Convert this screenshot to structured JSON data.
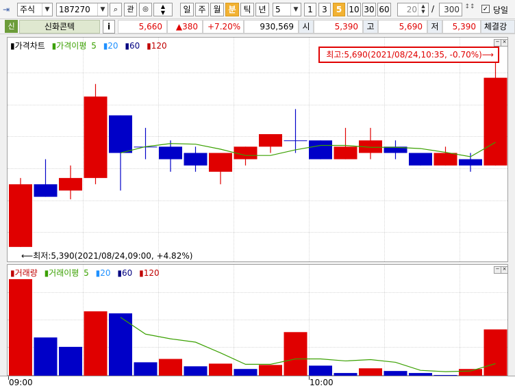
{
  "toolbar": {
    "market": "주식",
    "code": "187270",
    "buttons": [
      "관"
    ],
    "periods": [
      {
        "label": "일",
        "active": false
      },
      {
        "label": "주",
        "active": false
      },
      {
        "label": "월",
        "active": false
      },
      {
        "label": "분",
        "active": true
      },
      {
        "label": "틱",
        "active": false
      },
      {
        "label": "년",
        "active": false
      }
    ],
    "interval_value": "5",
    "minutes": [
      {
        "label": "1",
        "active": false
      },
      {
        "label": "3",
        "active": false
      },
      {
        "label": "5",
        "active": true
      },
      {
        "label": "10",
        "active": false
      },
      {
        "label": "30",
        "active": false
      },
      {
        "label": "60",
        "active": false
      }
    ],
    "count_value": "20",
    "slash": "/",
    "total_value": "300",
    "today_label": "당일",
    "today_checked": true
  },
  "quote": {
    "badge": "신",
    "name": "신화콘텍",
    "info_button": "i",
    "price": "5,660",
    "change": "▲380",
    "change_pct": "+7.20%",
    "volume": "930,569",
    "open_label": "시",
    "open": "5,390",
    "high_label": "고",
    "high": "5,690",
    "low_label": "저",
    "low": "5,390",
    "exec_label": "체결강"
  },
  "price_panel": {
    "legend": {
      "main": "가격차트",
      "ma_label": "가격이평",
      "ma5": "5",
      "ma20": "20",
      "ma60": "60",
      "ma120": "120"
    },
    "high_annotation": "최고:5,690(2021/08/24,10:35, -0.70%)⟶",
    "low_annotation": "⟵최저:5,390(2021/08/24,09:00, +4.82%)"
  },
  "volume_panel": {
    "legend": {
      "main": "거래량",
      "ma_label": "거래이평",
      "ma5": "5",
      "ma20": "20",
      "ma60": "60",
      "ma120": "120"
    }
  },
  "x_axis": [
    "09:00",
    "10:00"
  ],
  "colors": {
    "up": "#e00000",
    "down": "#0000c8",
    "ma5": "#3aa000",
    "ma20": "#1e90ff",
    "ma60": "#000080",
    "ma120": "#c00000"
  },
  "chart_data": [
    {
      "type": "candlestick",
      "title": "가격차트",
      "interval": "5분",
      "x": [
        "09:00",
        "09:05",
        "09:10",
        "09:15",
        "09:20",
        "09:25",
        "09:30",
        "09:35",
        "09:40",
        "09:45",
        "09:50",
        "09:55",
        "10:00",
        "10:05",
        "10:10",
        "10:15",
        "10:20",
        "10:25",
        "10:30",
        "10:35"
      ],
      "ylim": [
        5380,
        5700
      ],
      "candles": [
        {
          "o": 5390,
          "h": 5500,
          "l": 5390,
          "c": 5490,
          "dir": "up"
        },
        {
          "o": 5490,
          "h": 5530,
          "l": 5470,
          "c": 5470,
          "dir": "down"
        },
        {
          "o": 5480,
          "h": 5520,
          "l": 5466,
          "c": 5500,
          "dir": "up"
        },
        {
          "o": 5500,
          "h": 5650,
          "l": 5490,
          "c": 5630,
          "dir": "up"
        },
        {
          "o": 5600,
          "h": 5600,
          "l": 5480,
          "c": 5540,
          "dir": "down"
        },
        {
          "o": 5550,
          "h": 5580,
          "l": 5530,
          "c": 5550,
          "dir": "down"
        },
        {
          "o": 5550,
          "h": 5560,
          "l": 5510,
          "c": 5530,
          "dir": "down"
        },
        {
          "o": 5540,
          "h": 5550,
          "l": 5510,
          "c": 5520,
          "dir": "down"
        },
        {
          "o": 5510,
          "h": 5540,
          "l": 5490,
          "c": 5540,
          "dir": "up"
        },
        {
          "o": 5530,
          "h": 5550,
          "l": 5520,
          "c": 5550,
          "dir": "up"
        },
        {
          "o": 5550,
          "h": 5570,
          "l": 5540,
          "c": 5570,
          "dir": "up"
        },
        {
          "o": 5560,
          "h": 5610,
          "l": 5540,
          "c": 5560,
          "dir": "down"
        },
        {
          "o": 5560,
          "h": 5560,
          "l": 5530,
          "c": 5530,
          "dir": "down"
        },
        {
          "o": 5530,
          "h": 5580,
          "l": 5530,
          "c": 5550,
          "dir": "up"
        },
        {
          "o": 5540,
          "h": 5580,
          "l": 5530,
          "c": 5560,
          "dir": "up"
        },
        {
          "o": 5550,
          "h": 5560,
          "l": 5530,
          "c": 5540,
          "dir": "down"
        },
        {
          "o": 5540,
          "h": 5540,
          "l": 5520,
          "c": 5520,
          "dir": "down"
        },
        {
          "o": 5520,
          "h": 5550,
          "l": 5520,
          "c": 5540,
          "dir": "up"
        },
        {
          "o": 5530,
          "h": 5540,
          "l": 5510,
          "c": 5520,
          "dir": "down"
        },
        {
          "o": 5520,
          "h": 5690,
          "l": 5520,
          "c": 5660,
          "dir": "up"
        }
      ],
      "ma5": [
        null,
        null,
        null,
        null,
        5540,
        5550,
        5555,
        5554,
        5546,
        5536,
        5536,
        5545,
        5552,
        5552,
        5549,
        5549,
        5547,
        5541,
        5534,
        5557
      ]
    },
    {
      "type": "bar",
      "title": "거래량",
      "x": [
        "09:00",
        "09:05",
        "09:10",
        "09:15",
        "09:20",
        "09:25",
        "09:30",
        "09:35",
        "09:40",
        "09:45",
        "09:50",
        "09:55",
        "10:00",
        "10:05",
        "10:10",
        "10:15",
        "10:20",
        "10:25",
        "10:30",
        "10:35"
      ],
      "values": [
        145,
        58,
        44,
        97,
        94,
        21,
        26,
        15,
        19,
        11,
        17,
        66,
        16,
        5,
        12,
        8,
        5,
        2,
        11,
        70
      ],
      "dir": [
        "up",
        "down",
        "down",
        "up",
        "down",
        "down",
        "up",
        "down",
        "up",
        "down",
        "up",
        "up",
        "down",
        "down",
        "up",
        "down",
        "down",
        "down",
        "up",
        "up"
      ],
      "ma5": [
        null,
        null,
        null,
        null,
        88,
        63,
        56,
        51,
        35,
        18,
        18,
        26,
        26,
        23,
        25,
        21,
        9,
        7,
        8,
        19
      ],
      "ylim": [
        0,
        150
      ]
    }
  ]
}
